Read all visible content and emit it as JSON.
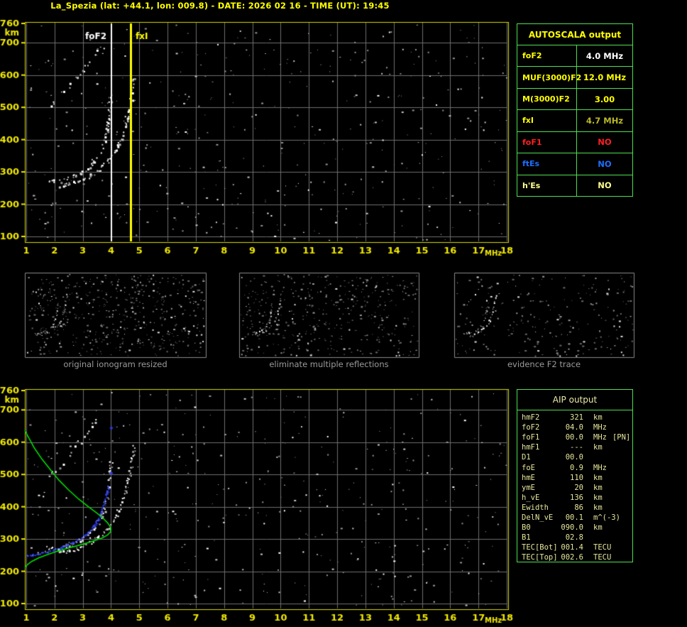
{
  "title": "La_Spezia (lat: +44.1, lon: 009.8) - DATE: 2026 02 16 - TIME (UT): 19:45",
  "colors": {
    "background": "#000000",
    "title_yellow": "#ffff00",
    "plot_border": "#d8d800",
    "grid": "#6e6e6e",
    "axis_labels": "#f0e800",
    "table_border": "#50dd50",
    "caption_gray": "#9a9a9a",
    "trace_white": "#ffffff",
    "profile_green": "#00dd00",
    "restored_blue": "#2b3cee",
    "status_red": "#ff2020",
    "status_blue": "#1e6eff",
    "pale_yellow": "#ffff90",
    "olive_yellow": "#b8b828",
    "value_white": "#ffffff"
  },
  "autoscala_table": {
    "title": "AUTOSCALA output",
    "rows": [
      {
        "label": "foF2",
        "value": "4.0 MHz",
        "label_color": "#ffff00",
        "value_color": "#ffffff"
      },
      {
        "label": "MUF(3000)F2",
        "value": "12.0 MHz",
        "label_color": "#ffff00",
        "value_color": "#ffff00"
      },
      {
        "label": "M(3000)F2",
        "value": "3.00",
        "label_color": "#ffff00",
        "value_color": "#ffff00"
      },
      {
        "label": "fxI",
        "value": "4.7 MHz",
        "label_color": "#ffff00",
        "value_color": "#b8b828"
      },
      {
        "label": "foF1",
        "value": "NO",
        "label_color": "#ff2020",
        "value_color": "#ff2020"
      },
      {
        "label": "ftEs",
        "value": "NO",
        "label_color": "#1e6eff",
        "value_color": "#1e6eff"
      },
      {
        "label": "h'Es",
        "value": "NO",
        "label_color": "#ffff90",
        "value_color": "#ffff90"
      }
    ]
  },
  "aip_table": {
    "title": "AIP output",
    "rows": [
      {
        "name": "hmF2",
        "value": "321",
        "unit": "km",
        "extra": ""
      },
      {
        "name": "foF2",
        "value": "04.0",
        "unit": "MHz",
        "extra": ""
      },
      {
        "name": "foF1",
        "value": "00.0",
        "unit": "MHz",
        "extra": "[PN]"
      },
      {
        "name": "hmF1",
        "value": "---",
        "unit": "km",
        "extra": ""
      },
      {
        "name": "D1",
        "value": "00.0",
        "unit": "",
        "extra": ""
      },
      {
        "name": "foE",
        "value": "0.9",
        "unit": "MHz",
        "extra": ""
      },
      {
        "name": "hmE",
        "value": "110",
        "unit": "km",
        "extra": ""
      },
      {
        "name": "ymE",
        "value": "20",
        "unit": "km",
        "extra": ""
      },
      {
        "name": "h_vE",
        "value": "136",
        "unit": "km",
        "extra": ""
      },
      {
        "name": "Ewidth",
        "value": "86",
        "unit": "km",
        "extra": ""
      },
      {
        "name": "DelN_vE",
        "value": "00.1",
        "unit": "m^(-3)",
        "extra": ""
      },
      {
        "name": "B0",
        "value": "090.0",
        "unit": "km",
        "extra": ""
      },
      {
        "name": "B1",
        "value": "02.8",
        "unit": "",
        "extra": ""
      },
      {
        "name": "TEC[Bot]",
        "value": "001.4",
        "unit": "TECU",
        "extra": ""
      },
      {
        "name": "TEC[Top]",
        "value": "002.6",
        "unit": "TECU",
        "extra": ""
      }
    ]
  },
  "thumbnails": {
    "items": [
      {
        "caption": "original ionogram resized",
        "seed": 101,
        "noise_count": 520,
        "series": [
          "f2_trace_ordinary",
          "f2_trace_extraordinary",
          "f2_second_hop"
        ]
      },
      {
        "caption": "eliminate multiple reflections",
        "seed": 202,
        "noise_count": 430,
        "series": [
          "f2_trace_ordinary",
          "f2_trace_extraordinary",
          "f2_second_hop"
        ]
      },
      {
        "caption": "evidence F2 trace",
        "seed": 303,
        "noise_count": 240,
        "series": [
          "f2_trace_ordinary",
          "f2_trace_extraordinary",
          "f2_second_hop"
        ]
      }
    ]
  },
  "chart_data": {
    "type": "scatter",
    "plots": [
      {
        "id": "autoscala-ionogram",
        "xlabel": "MHz",
        "ylabel": "km",
        "xlim": [
          1,
          18
        ],
        "ylim": [
          100,
          760
        ],
        "xticks": [
          1,
          2,
          3,
          4,
          5,
          6,
          7,
          8,
          9,
          10,
          11,
          12,
          13,
          14,
          15,
          16,
          17,
          18
        ],
        "yticks": [
          760,
          700,
          600,
          500,
          400,
          300,
          200,
          100
        ],
        "grid": true,
        "series": [
          "f2_trace_ordinary",
          "f2_trace_extraordinary",
          "f2_second_hop"
        ],
        "overlays": [],
        "markers": [
          {
            "label": "foF2",
            "x": 4.0,
            "color": "#ffffff",
            "side": "left"
          },
          {
            "label": "fxI",
            "x": 4.7,
            "color": "#ffff00",
            "side": "right"
          }
        ],
        "noise": {
          "seed": 1203,
          "count": 440
        }
      },
      {
        "id": "aip-ionogram",
        "xlabel": "MHz",
        "ylabel": "km",
        "xlim": [
          1,
          18
        ],
        "ylim": [
          100,
          760
        ],
        "xticks": [
          1,
          2,
          3,
          4,
          5,
          6,
          7,
          8,
          9,
          10,
          11,
          12,
          13,
          14,
          15,
          16,
          17,
          18
        ],
        "yticks": [
          760,
          700,
          600,
          500,
          400,
          300,
          200,
          100
        ],
        "grid": true,
        "series": [
          "f2_trace_ordinary",
          "f2_trace_extraordinary",
          "f2_second_hop"
        ],
        "overlays": [
          "electron_density_profile",
          "aip_restored_trace"
        ],
        "markers": [],
        "noise": {
          "seed": 417,
          "count": 440
        }
      }
    ],
    "series_points": {
      "f2_trace_ordinary": {
        "color": "#ffffff",
        "style": "speckle",
        "points": [
          [
            1.7,
            268
          ],
          [
            1.95,
            271
          ],
          [
            2.2,
            275
          ],
          [
            2.45,
            280
          ],
          [
            2.7,
            287
          ],
          [
            2.95,
            297
          ],
          [
            3.15,
            310
          ],
          [
            3.35,
            327
          ],
          [
            3.52,
            348
          ],
          [
            3.65,
            372
          ],
          [
            3.76,
            400
          ],
          [
            3.84,
            432
          ],
          [
            3.9,
            468
          ],
          [
            3.95,
            505
          ],
          [
            3.98,
            540
          ]
        ]
      },
      "f2_trace_extraordinary": {
        "color": "#ffffff",
        "style": "speckle",
        "points": [
          [
            2.15,
            258
          ],
          [
            2.45,
            263
          ],
          [
            2.75,
            270
          ],
          [
            3.05,
            280
          ],
          [
            3.35,
            294
          ],
          [
            3.6,
            312
          ],
          [
            3.85,
            333
          ],
          [
            4.05,
            356
          ],
          [
            4.22,
            382
          ],
          [
            4.37,
            412
          ],
          [
            4.5,
            445
          ],
          [
            4.6,
            482
          ],
          [
            4.69,
            520
          ],
          [
            4.76,
            558
          ],
          [
            4.8,
            592
          ]
        ]
      },
      "f2_second_hop": {
        "color": "#c8c8c8",
        "style": "speckle",
        "sparse": true,
        "points": [
          [
            1.75,
            492
          ],
          [
            2.0,
            516
          ],
          [
            2.25,
            541
          ],
          [
            2.5,
            566
          ],
          [
            2.75,
            591
          ],
          [
            3.0,
            617
          ],
          [
            3.2,
            644
          ],
          [
            3.4,
            668
          ],
          [
            3.5,
            686
          ]
        ]
      },
      "electron_density_profile": {
        "color": "#00dd00",
        "style": "line",
        "points": [
          [
            0.95,
            636
          ],
          [
            1.1,
            612
          ],
          [
            1.3,
            580
          ],
          [
            1.55,
            548
          ],
          [
            1.85,
            515
          ],
          [
            2.15,
            483
          ],
          [
            2.5,
            452
          ],
          [
            2.85,
            424
          ],
          [
            3.2,
            400
          ],
          [
            3.5,
            380
          ],
          [
            3.72,
            364
          ],
          [
            3.88,
            350
          ],
          [
            3.97,
            338
          ],
          [
            4.0,
            330
          ],
          [
            3.97,
            321
          ],
          [
            3.87,
            312
          ],
          [
            3.68,
            303
          ],
          [
            3.42,
            295
          ],
          [
            3.12,
            287
          ],
          [
            2.8,
            279
          ],
          [
            2.45,
            271
          ],
          [
            2.1,
            262
          ],
          [
            1.75,
            252
          ],
          [
            1.45,
            242
          ],
          [
            1.2,
            231
          ],
          [
            1.02,
            219
          ],
          [
            0.95,
            211
          ]
        ]
      },
      "aip_restored_trace": {
        "color": "#2b3cee",
        "style": "dots",
        "points": [
          [
            1.02,
            247
          ],
          [
            1.25,
            250
          ],
          [
            1.5,
            254
          ],
          [
            1.75,
            259
          ],
          [
            2.0,
            265
          ],
          [
            2.25,
            272
          ],
          [
            2.5,
            281
          ],
          [
            2.75,
            292
          ],
          [
            3.0,
            305
          ],
          [
            3.2,
            320
          ],
          [
            3.4,
            339
          ],
          [
            3.55,
            360
          ],
          [
            3.68,
            385
          ],
          [
            3.78,
            412
          ],
          [
            3.86,
            440
          ],
          [
            3.91,
            462
          ]
        ],
        "extra_points": [
          [
            4.0,
            505
          ],
          [
            4.0,
            645
          ]
        ]
      }
    }
  }
}
